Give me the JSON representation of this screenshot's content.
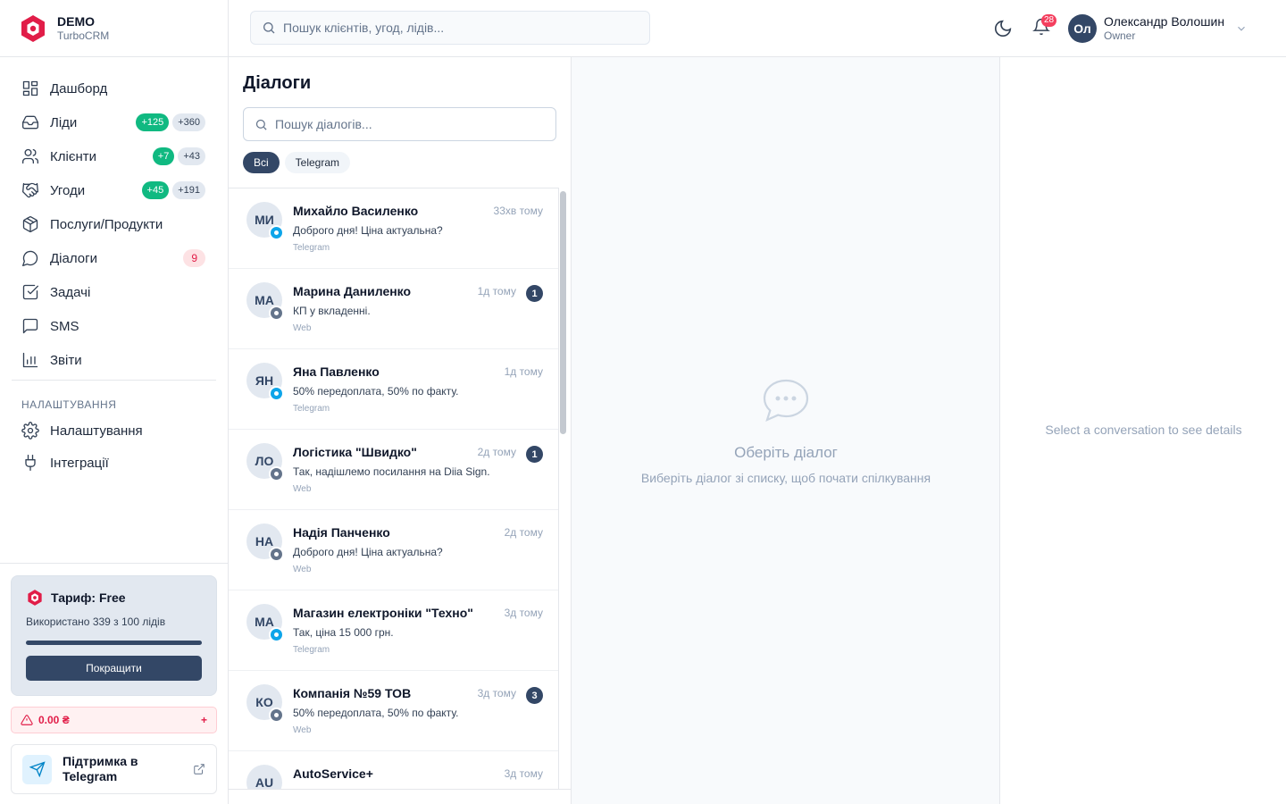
{
  "brand": {
    "title": "DEMO",
    "subtitle": "TurboCRM"
  },
  "search": {
    "placeholder": "Пошук клієнтів, угод, лідів..."
  },
  "sidebar": {
    "items": [
      {
        "label": "Дашборд",
        "icon": "dashboard-icon"
      },
      {
        "label": "Ліди",
        "icon": "inbox-icon",
        "badge_new": "+125",
        "badge_total": "+360"
      },
      {
        "label": "Клієнти",
        "icon": "users-icon",
        "badge_new": "+7",
        "badge_total": "+43"
      },
      {
        "label": "Угоди",
        "icon": "handshake-icon",
        "badge_new": "+45",
        "badge_total": "+191"
      },
      {
        "label": "Послуги/Продукти",
        "icon": "package-icon"
      },
      {
        "label": "Діалоги",
        "icon": "chat-icon",
        "badge_count": "9"
      },
      {
        "label": "Задачі",
        "icon": "checkbox-icon"
      },
      {
        "label": "SMS",
        "icon": "sms-icon"
      },
      {
        "label": "Звіти",
        "icon": "bar-chart-icon"
      }
    ],
    "settings_title": "НАЛАШТУВАННЯ",
    "settings_items": [
      {
        "label": "Налаштування",
        "icon": "gear-icon"
      },
      {
        "label": "Інтеграції",
        "icon": "plug-icon"
      }
    ],
    "plan": {
      "title": "Тариф: Free",
      "used": "Використано 339 з 100 лідів",
      "usage_fraction": 1.0,
      "upgrade_label": "Покращити"
    },
    "balance": {
      "amount": "0.00 ₴",
      "plus": "+"
    },
    "support": {
      "label": "Підтримка в Telegram"
    }
  },
  "header": {
    "notifications": "28",
    "user": {
      "initials": "Ол",
      "name": "Олександр Волошин",
      "role": "Owner"
    }
  },
  "dialogs": {
    "title": "Діалоги",
    "search_placeholder": "Пошук діалогів...",
    "filters": [
      "Всі",
      "Telegram"
    ],
    "items": [
      {
        "initials": "МИ",
        "name": "Михайло Василенко",
        "time": "33хв тому",
        "message": "Доброго дня! Ціна актуальна?",
        "channel": "Telegram",
        "unread": ""
      },
      {
        "initials": "МА",
        "name": "Марина Даниленко",
        "time": "1д тому",
        "message": "КП у вкладенні.",
        "channel": "Web",
        "unread": "1"
      },
      {
        "initials": "ЯН",
        "name": "Яна Павленко",
        "time": "1д тому",
        "message": "50% передоплата, 50% по факту.",
        "channel": "Telegram",
        "unread": ""
      },
      {
        "initials": "ЛО",
        "name": "Логістика \"Швидко\"",
        "time": "2д тому",
        "message": "Так, надішлемо посилання на Diia Sign.",
        "channel": "Web",
        "unread": "1"
      },
      {
        "initials": "НА",
        "name": "Надія Панченко",
        "time": "2д тому",
        "message": "Доброго дня! Ціна актуальна?",
        "channel": "Web",
        "unread": ""
      },
      {
        "initials": "МА",
        "name": "Магазин електроніки \"Техно\"",
        "time": "3д тому",
        "message": "Так, ціна 15 000 грн.",
        "channel": "Telegram",
        "unread": ""
      },
      {
        "initials": "КО",
        "name": "Компанія №59 ТОВ",
        "time": "3д тому",
        "message": "50% передоплата, 50% по факту.",
        "channel": "Web",
        "unread": "3"
      },
      {
        "initials": "AU",
        "name": "AutoService+",
        "time": "3д тому",
        "message": "",
        "channel": "",
        "unread": ""
      }
    ]
  },
  "empty_state": {
    "title": "Оберіть діалог",
    "subtitle": "Виберіть діалог зі списку, щоб почати спілкування"
  },
  "details": {
    "placeholder": "Select a conversation to see details"
  }
}
